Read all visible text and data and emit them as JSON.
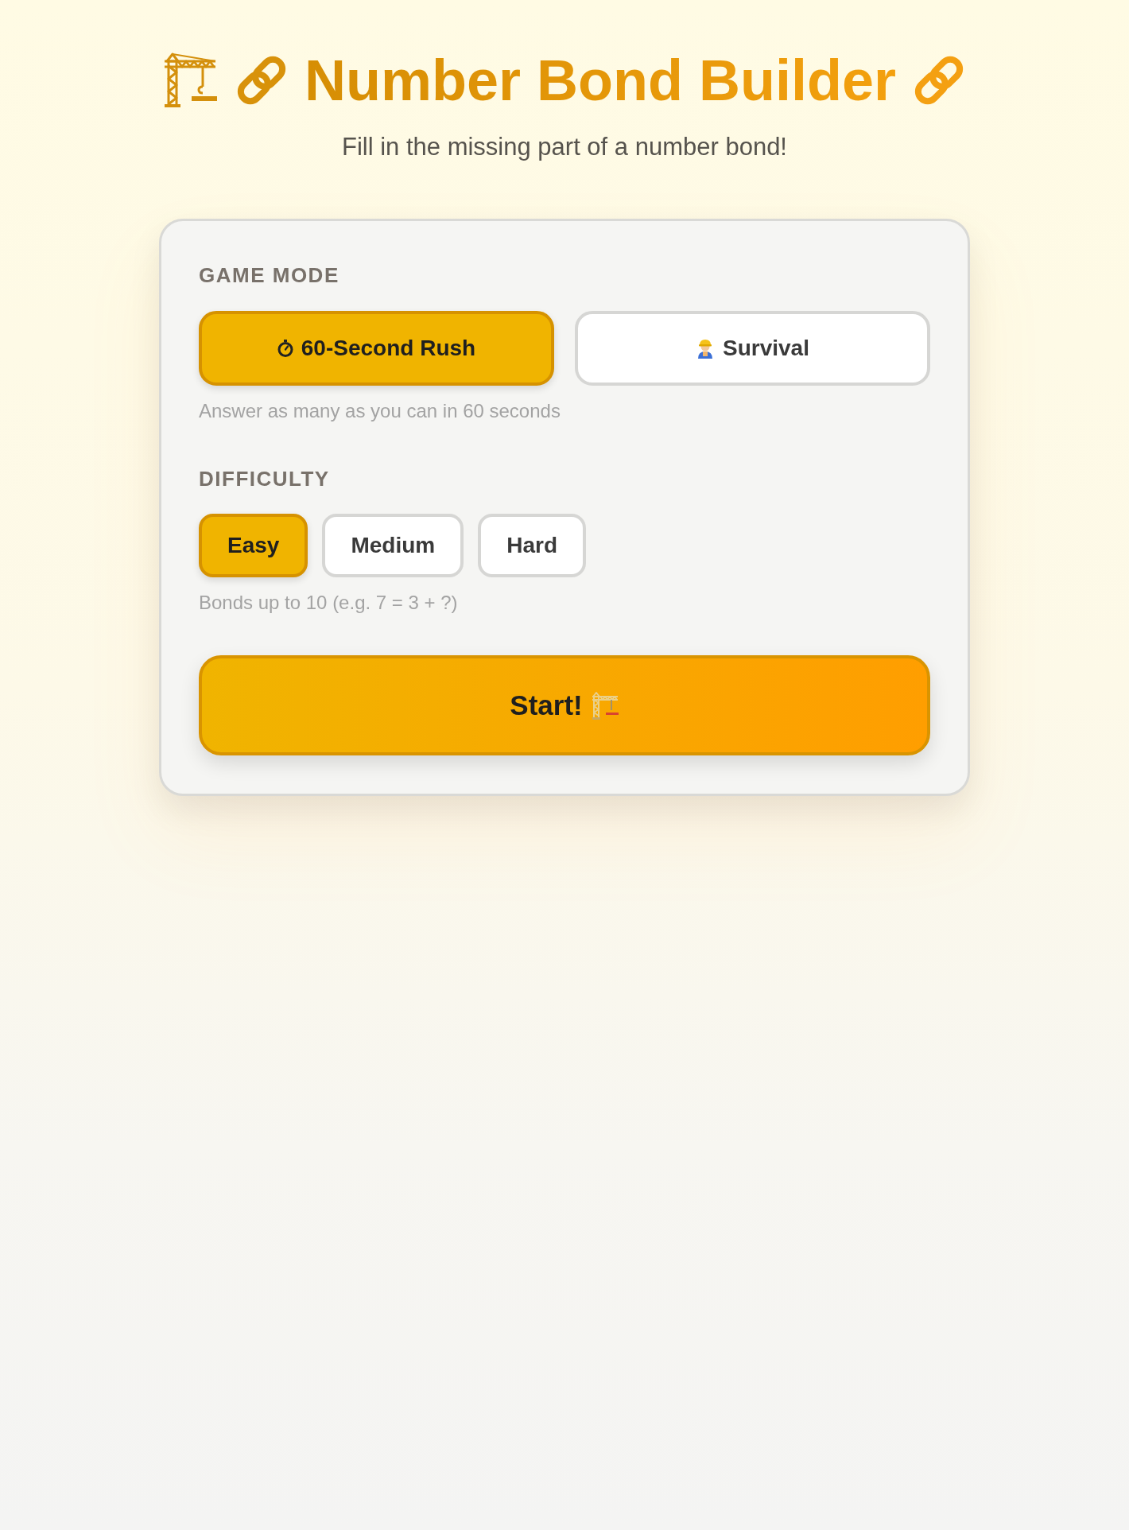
{
  "header": {
    "title": "Number Bond Builder",
    "subtitle": "Fill in the missing part of a number bond!"
  },
  "setup": {
    "game_mode": {
      "label": "GAME MODE",
      "options": [
        {
          "label": "60-Second Rush",
          "selected": true
        },
        {
          "label": "Survival",
          "selected": false
        }
      ],
      "hint": "Answer as many as you can in 60 seconds"
    },
    "difficulty": {
      "label": "DIFFICULTY",
      "options": [
        {
          "label": "Easy",
          "selected": true
        },
        {
          "label": "Medium",
          "selected": false
        },
        {
          "label": "Hard",
          "selected": false
        }
      ],
      "hint": "Bonds up to 10 (e.g. 7 = 3 + ?)"
    },
    "start_button": {
      "label": "Start!"
    }
  }
}
